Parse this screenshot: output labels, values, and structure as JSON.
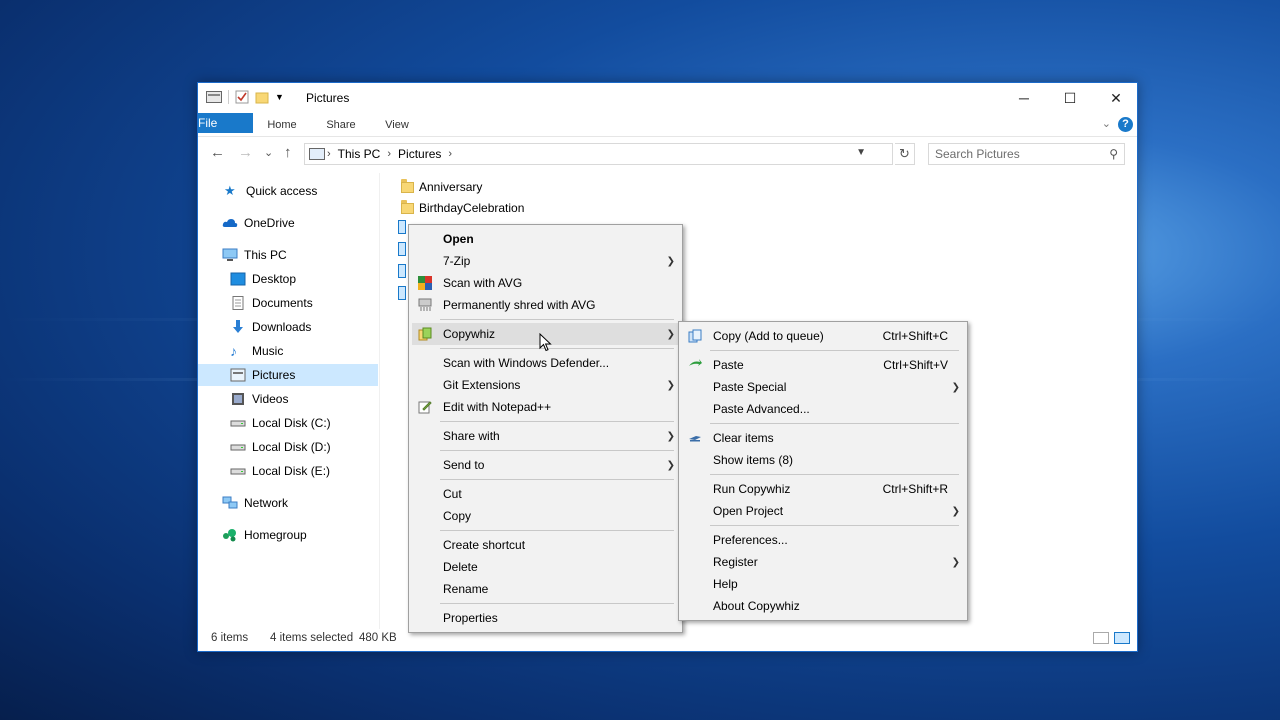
{
  "window": {
    "title": "Pictures",
    "ribbon_tabs": [
      "File",
      "Home",
      "Share",
      "View"
    ],
    "help_label": "?",
    "controls": {
      "minimize": "─",
      "maximize": "☐",
      "close": "✕"
    }
  },
  "navbar": {
    "back": "←",
    "forward": "→",
    "recent": "⌄",
    "up": "↑",
    "breadcrumb": [
      "This PC",
      "Pictures"
    ],
    "search_placeholder": "Search Pictures"
  },
  "sidebar": {
    "items": [
      {
        "label": "Quick access",
        "icon": "star-icon"
      },
      {
        "label": "OneDrive",
        "icon": "cloud-icon"
      },
      {
        "label": "This PC",
        "icon": "computer-icon"
      },
      {
        "label": "Desktop",
        "icon": "desktop-icon"
      },
      {
        "label": "Documents",
        "icon": "document-icon"
      },
      {
        "label": "Downloads",
        "icon": "download-icon"
      },
      {
        "label": "Music",
        "icon": "music-icon"
      },
      {
        "label": "Pictures",
        "icon": "pictures-icon"
      },
      {
        "label": "Videos",
        "icon": "video-icon"
      },
      {
        "label": "Local Disk (C:)",
        "icon": "drive-icon"
      },
      {
        "label": "Local Disk (D:)",
        "icon": "drive-icon"
      },
      {
        "label": "Local Disk (E:)",
        "icon": "drive-icon"
      },
      {
        "label": "Network",
        "icon": "network-icon"
      },
      {
        "label": "Homegroup",
        "icon": "homegroup-icon"
      }
    ]
  },
  "files": [
    {
      "name": "Anniversary",
      "type": "folder"
    },
    {
      "name": "BirthdayCelebration",
      "type": "folder"
    }
  ],
  "status": {
    "item_count": "6 items",
    "selection": "4 items selected",
    "size": "480 KB"
  },
  "context_menu": {
    "open": "Open",
    "zip": "7-Zip",
    "scan_avg": "Scan with AVG",
    "shred_avg": "Permanently shred with AVG",
    "copywhiz": "Copywhiz",
    "defender": "Scan with Windows Defender...",
    "git": "Git Extensions",
    "notepad": "Edit with Notepad++",
    "share": "Share with",
    "send": "Send to",
    "cut": "Cut",
    "copy": "Copy",
    "shortcut": "Create shortcut",
    "delete": "Delete",
    "rename": "Rename",
    "properties": "Properties"
  },
  "copywhiz_menu": {
    "copy_queue": "Copy (Add to queue)",
    "copy_queue_key": "Ctrl+Shift+C",
    "paste": "Paste",
    "paste_key": "Ctrl+Shift+V",
    "paste_special": "Paste Special",
    "paste_advanced": "Paste Advanced...",
    "clear": "Clear items",
    "show": "Show items (8)",
    "run": "Run Copywhiz",
    "run_key": "Ctrl+Shift+R",
    "open_project": "Open Project",
    "prefs": "Preferences...",
    "register": "Register",
    "help": "Help",
    "about": "About Copywhiz"
  },
  "colors": {
    "accent": "#1979ca",
    "selection": "#cce8ff",
    "menu_bg": "#f2f2f2"
  }
}
